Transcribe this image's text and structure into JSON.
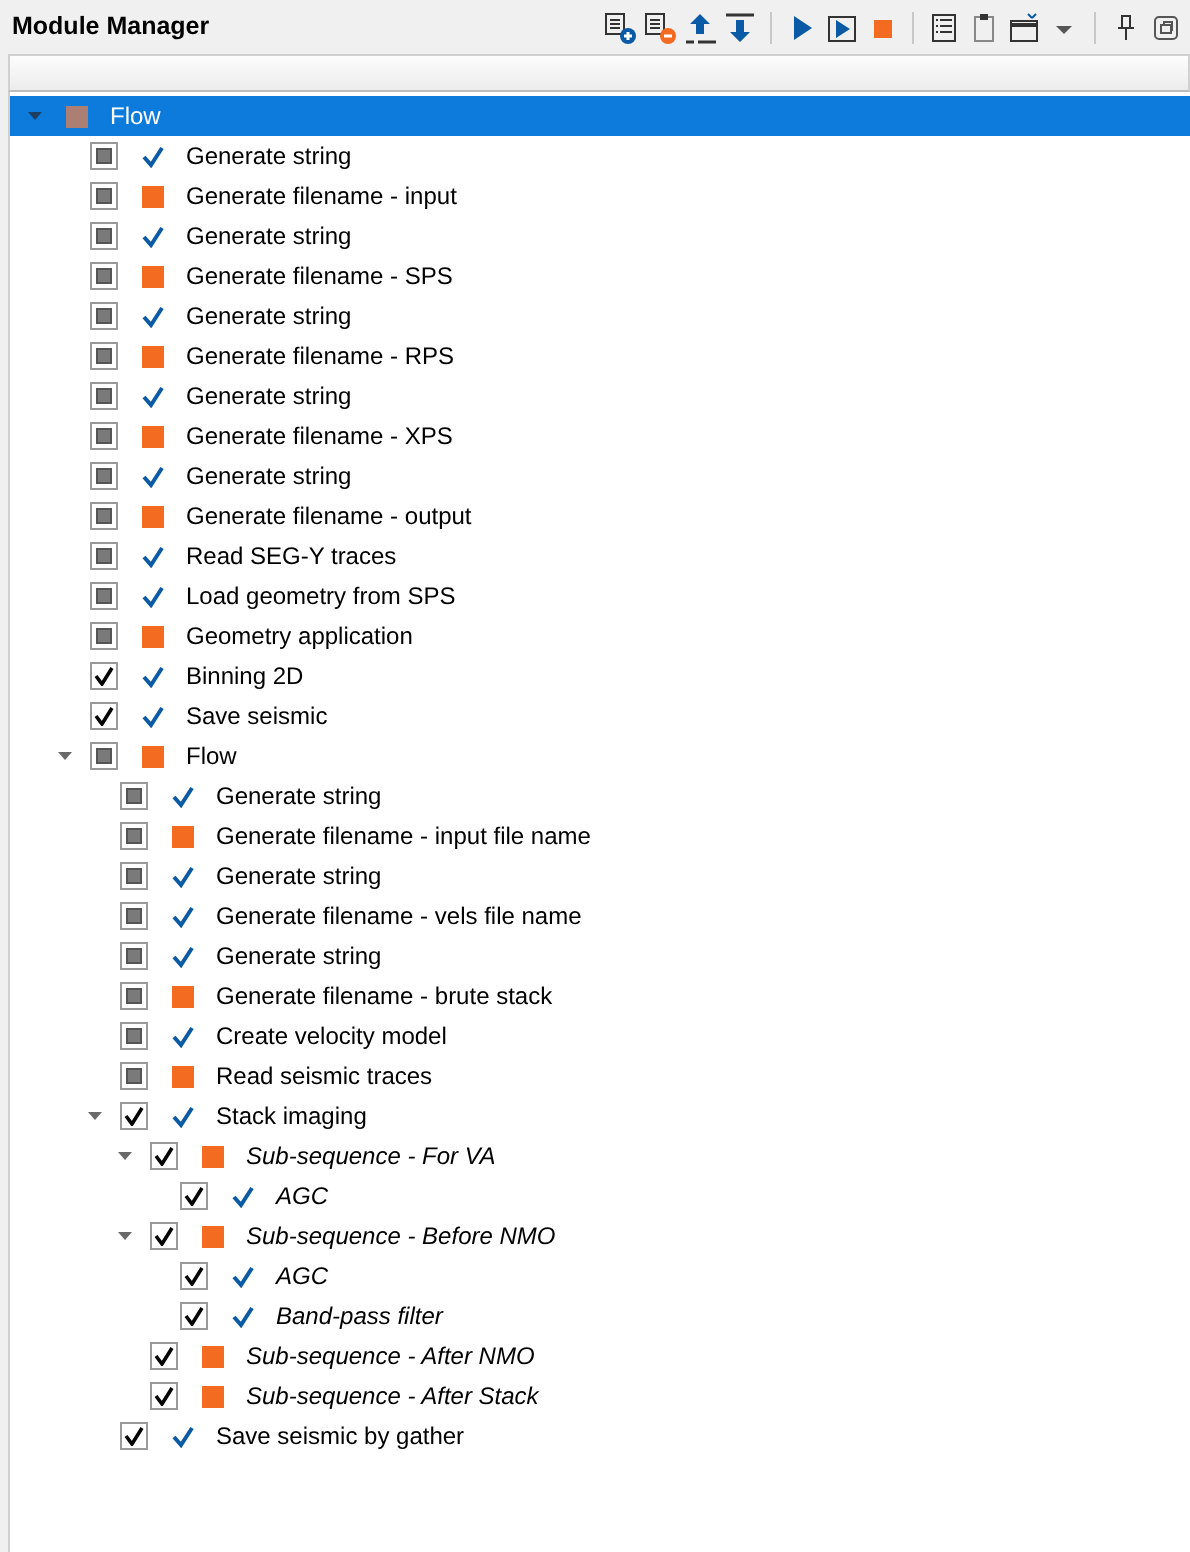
{
  "panel": {
    "title": "Module Manager"
  },
  "tree": [
    {
      "label": "Flow",
      "selected": true,
      "expanded": true,
      "kind": "pending",
      "italic": false,
      "children": [
        {
          "label": "Generate string",
          "selected": false,
          "checked": false,
          "kind": "done",
          "italic": false
        },
        {
          "label": "Generate filename - input",
          "selected": false,
          "checked": false,
          "kind": "pending",
          "italic": false
        },
        {
          "label": "Generate string",
          "selected": false,
          "checked": false,
          "kind": "done",
          "italic": false
        },
        {
          "label": "Generate filename - SPS",
          "selected": false,
          "checked": false,
          "kind": "pending",
          "italic": false
        },
        {
          "label": "Generate string",
          "selected": false,
          "checked": false,
          "kind": "done",
          "italic": false
        },
        {
          "label": "Generate filename - RPS",
          "selected": false,
          "checked": false,
          "kind": "pending",
          "italic": false
        },
        {
          "label": "Generate string",
          "selected": false,
          "checked": false,
          "kind": "done",
          "italic": false
        },
        {
          "label": "Generate filename - XPS",
          "selected": false,
          "checked": false,
          "kind": "pending",
          "italic": false
        },
        {
          "label": "Generate string",
          "selected": false,
          "checked": false,
          "kind": "done",
          "italic": false
        },
        {
          "label": "Generate filename - output",
          "selected": false,
          "checked": false,
          "kind": "pending",
          "italic": false
        },
        {
          "label": "Read SEG-Y traces",
          "selected": false,
          "checked": false,
          "kind": "done",
          "italic": false
        },
        {
          "label": "Load geometry from SPS",
          "selected": false,
          "checked": false,
          "kind": "done",
          "italic": false
        },
        {
          "label": "Geometry application",
          "selected": false,
          "checked": false,
          "kind": "pending",
          "italic": false
        },
        {
          "label": "Binning 2D",
          "selected": false,
          "checked": true,
          "kind": "done",
          "italic": false
        },
        {
          "label": "Save seismic",
          "selected": false,
          "checked": true,
          "kind": "done",
          "italic": false
        },
        {
          "label": "Flow",
          "selected": false,
          "checked": false,
          "kind": "pending",
          "italic": false,
          "expanded": true,
          "children": [
            {
              "label": "Generate string",
              "selected": false,
              "checked": false,
              "kind": "done",
              "italic": false
            },
            {
              "label": "Generate filename - input file name",
              "selected": false,
              "checked": false,
              "kind": "pending",
              "italic": false
            },
            {
              "label": "Generate string",
              "selected": false,
              "checked": false,
              "kind": "done",
              "italic": false
            },
            {
              "label": "Generate filename - vels file name",
              "selected": false,
              "checked": false,
              "kind": "done",
              "italic": false
            },
            {
              "label": "Generate string",
              "selected": false,
              "checked": false,
              "kind": "done",
              "italic": false
            },
            {
              "label": "Generate filename - brute stack",
              "selected": false,
              "checked": false,
              "kind": "pending",
              "italic": false
            },
            {
              "label": "Create velocity model",
              "selected": false,
              "checked": false,
              "kind": "done",
              "italic": false
            },
            {
              "label": "Read seismic traces",
              "selected": false,
              "checked": false,
              "kind": "pending",
              "italic": false
            },
            {
              "label": "Stack imaging",
              "selected": false,
              "checked": true,
              "kind": "done",
              "italic": false,
              "expanded": true,
              "children": [
                {
                  "label": "Sub-sequence - For VA",
                  "selected": false,
                  "checked": true,
                  "kind": "pending",
                  "italic": true,
                  "expanded": true,
                  "children": [
                    {
                      "label": "AGC",
                      "selected": false,
                      "checked": true,
                      "kind": "done",
                      "italic": true
                    }
                  ]
                },
                {
                  "label": "Sub-sequence - Before NMO",
                  "selected": false,
                  "checked": true,
                  "kind": "pending",
                  "italic": true,
                  "expanded": true,
                  "children": [
                    {
                      "label": "AGC",
                      "selected": false,
                      "checked": true,
                      "kind": "done",
                      "italic": true
                    },
                    {
                      "label": "Band-pass filter",
                      "selected": false,
                      "checked": true,
                      "kind": "done",
                      "italic": true
                    }
                  ]
                },
                {
                  "label": "Sub-sequence - After NMO",
                  "selected": false,
                  "checked": true,
                  "kind": "pending",
                  "italic": true
                },
                {
                  "label": "Sub-sequence - After Stack",
                  "selected": false,
                  "checked": true,
                  "kind": "pending",
                  "italic": true
                }
              ]
            },
            {
              "label": "Save seismic by gather",
              "selected": false,
              "checked": true,
              "kind": "done",
              "italic": false
            }
          ]
        }
      ]
    }
  ]
}
